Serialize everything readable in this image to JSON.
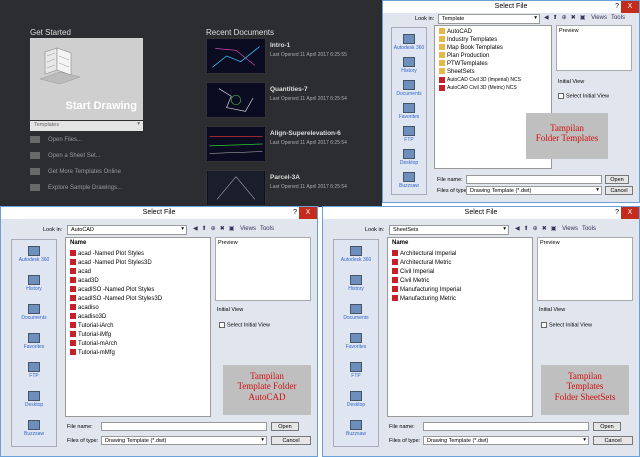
{
  "start_page": {
    "get_started_title": "Get Started",
    "start_drawing_label": "Start Drawing",
    "templates_label": "Templates",
    "menu": [
      "Open Files...",
      "Open a Sheet Set...",
      "Get More Templates Online",
      "Explore Sample Drawings..."
    ],
    "recent_title": "Recent Documents",
    "recent": [
      {
        "name": "Intro-1",
        "opened": "Last Opened 11 April 2017 6:25:55"
      },
      {
        "name": "Quantities-7",
        "opened": "Last Opened 11 April 2017 6:25:54"
      },
      {
        "name": "Align-Superelevation-6",
        "opened": "Last Opened 11 April 2017 6:25:54"
      },
      {
        "name": "Parcel-3A",
        "opened": "Last Opened 11 April 2017 6:25:54"
      }
    ]
  },
  "common": {
    "title": "Select File",
    "help": "?",
    "close": "X",
    "look_in": "Look in:",
    "views": "Views",
    "tools": "Tools",
    "name_header": "Name",
    "preview": "Preview",
    "initial_view": "Initial View",
    "select_initial_view": "Select Initial View",
    "file_name": "File name:",
    "files_of_type": "Files of type:",
    "file_type_value": "Drawing Template (*.dwt)",
    "open": "Open",
    "cancel": "Cancel",
    "places": [
      "Autodesk 360",
      "History",
      "Documents",
      "Favorites",
      "FTP",
      "Desktop",
      "Buzzsaw"
    ]
  },
  "dialog_templates": {
    "look_in_value": "Template",
    "files": [
      {
        "name": "AutoCAD",
        "kind": "folder"
      },
      {
        "name": "Industry Templates",
        "kind": "folder"
      },
      {
        "name": "Map Book Templates",
        "kind": "folder"
      },
      {
        "name": "Plan Production",
        "kind": "folder"
      },
      {
        "name": "PTWTemplates",
        "kind": "folder"
      },
      {
        "name": "SheetSets",
        "kind": "folder"
      },
      {
        "name": "AutoCAD Civil 3D (Imperial) NCS",
        "kind": "dwt"
      },
      {
        "name": "AutoCAD Civil 3D (Metric) NCS",
        "kind": "dwt"
      }
    ],
    "caption": [
      "Tampilan",
      "Folder Templates"
    ]
  },
  "dialog_autocad": {
    "look_in_value": "AutoCAD",
    "files": [
      {
        "name": "acad -Named Plot Styles",
        "kind": "dwt"
      },
      {
        "name": "acad -Named Plot Styles3D",
        "kind": "dwt"
      },
      {
        "name": "acad",
        "kind": "dwt"
      },
      {
        "name": "acad3D",
        "kind": "dwt"
      },
      {
        "name": "acadISO -Named Plot Styles",
        "kind": "dwt"
      },
      {
        "name": "acadISO -Named Plot Styles3D",
        "kind": "dwt"
      },
      {
        "name": "acadiso",
        "kind": "dwt"
      },
      {
        "name": "acadiso3D",
        "kind": "dwt"
      },
      {
        "name": "Tutorial-iArch",
        "kind": "dwt"
      },
      {
        "name": "Tutorial-iMfg",
        "kind": "dwt"
      },
      {
        "name": "Tutorial-mArch",
        "kind": "dwt"
      },
      {
        "name": "Tutorial-mMfg",
        "kind": "dwt"
      }
    ],
    "caption": [
      "Tampilan",
      "Template Folder",
      "AutoCAD"
    ]
  },
  "dialog_sheetsets": {
    "look_in_value": "SheetSets",
    "files": [
      {
        "name": "Architectural Imperial",
        "kind": "dwt"
      },
      {
        "name": "Architectural Metric",
        "kind": "dwt"
      },
      {
        "name": "Civil Imperial",
        "kind": "dwt"
      },
      {
        "name": "Civil Metric",
        "kind": "dwt"
      },
      {
        "name": "Manufacturing Imperial",
        "kind": "dwt"
      },
      {
        "name": "Manufacturing Metric",
        "kind": "dwt"
      }
    ],
    "caption": [
      "Tampilan",
      "Templates",
      "Folder SheetSets"
    ]
  }
}
